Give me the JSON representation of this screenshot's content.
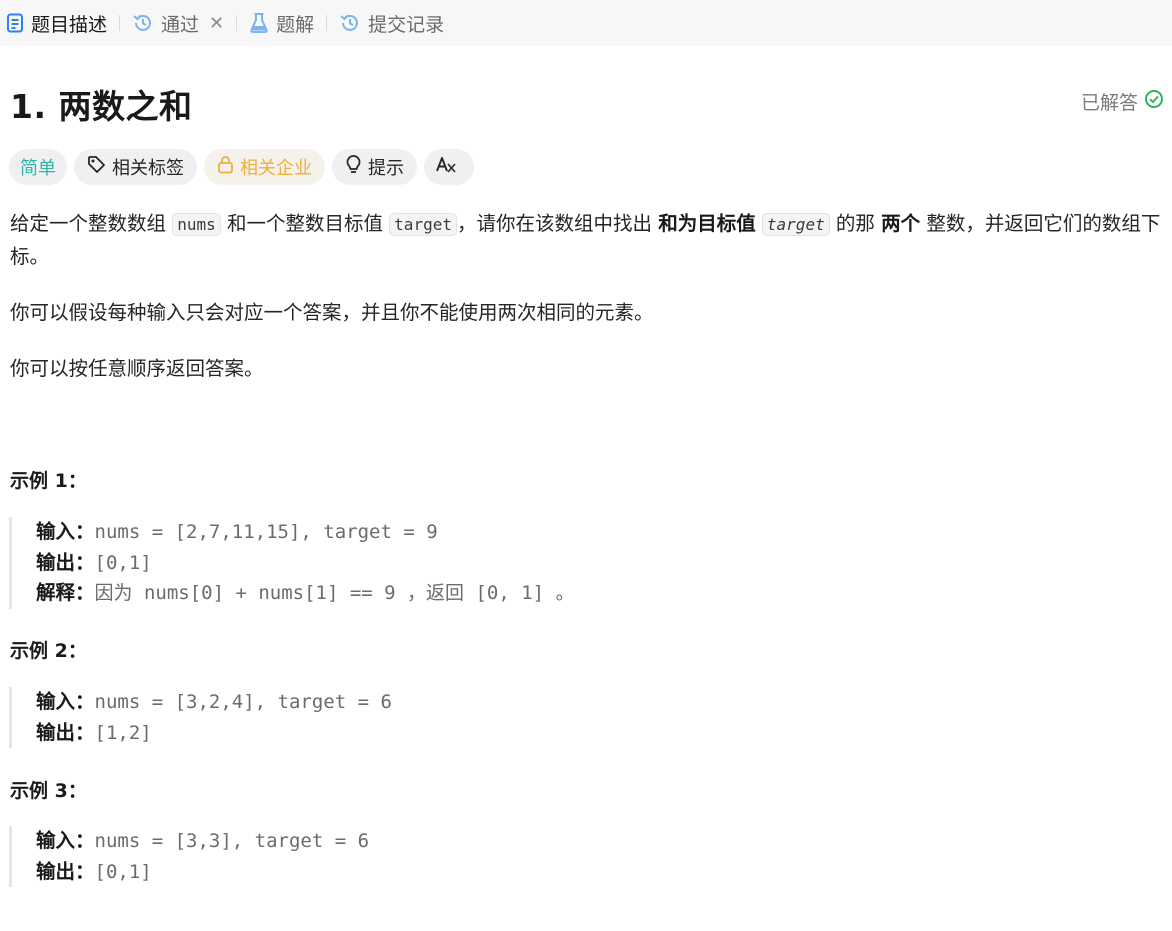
{
  "tabs": {
    "description": "题目描述",
    "solutions_history": "通过",
    "editorial": "题解",
    "submissions": "提交记录"
  },
  "problem": {
    "title": "1. 两数之和",
    "status": "已解答",
    "tags": {
      "difficulty": "简单",
      "related_tags": "相关标签",
      "related_companies": "相关企业",
      "hint": "提示"
    }
  },
  "description": {
    "p1": {
      "t1": "给定一个整数数组",
      "code1": "nums",
      "t2": "和一个整数目标值",
      "code2": "target",
      "t3": "，请你在该数组中找出",
      "b1": "和为目标值",
      "code3": "target",
      "t4": "的那",
      "b2": "两个",
      "t5": "整数，并返回它们的数组下标。"
    },
    "p2": "你可以假设每种输入只会对应一个答案，并且你不能使用两次相同的元素。",
    "p3": "你可以按任意顺序返回答案。"
  },
  "examples": [
    {
      "title": "示例 1：",
      "input_label": "输入：",
      "input": "nums = [2,7,11,15], target = 9",
      "output_label": "输出：",
      "output": "[0,1]",
      "explain_label": "解释：",
      "explain": "因为 nums[0] + nums[1] == 9 ，返回 [0, 1] 。"
    },
    {
      "title": "示例 2：",
      "input_label": "输入：",
      "input": "nums = [3,2,4], target = 6",
      "output_label": "输出：",
      "output": "[1,2]"
    },
    {
      "title": "示例 3：",
      "input_label": "输入：",
      "input": "nums = [3,3], target = 6",
      "output_label": "输出：",
      "output": "[0,1]"
    }
  ],
  "colors": {
    "accent_blue": "#2f80ed",
    "easy": "#2cb5a8",
    "locked": "#f0ad3e",
    "solved": "#2db55d"
  },
  "icons": {
    "description": "document-icon",
    "history": "history-icon",
    "close": "close-icon",
    "editorial": "flask-icon",
    "submissions": "history-icon",
    "solved": "check-circle-icon",
    "tag": "tag-icon",
    "lock": "lock-icon",
    "hint": "lightbulb-icon",
    "translate": "translate-icon"
  }
}
